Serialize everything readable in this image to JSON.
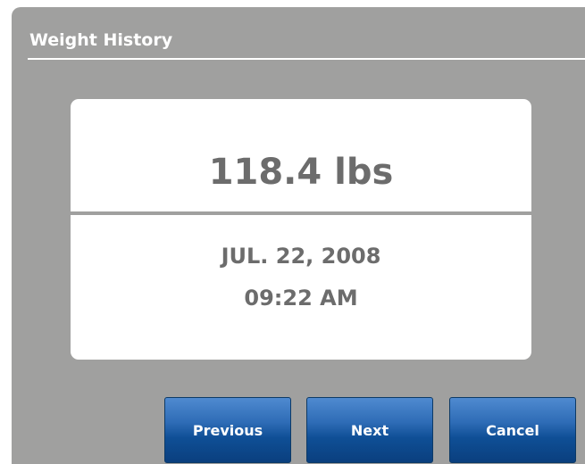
{
  "header": {
    "title": "Weight History"
  },
  "record": {
    "weight": "118.4 lbs",
    "date": "JUL. 22, 2008",
    "time": "09:22 AM"
  },
  "buttons": {
    "previous_label": "Previous",
    "next_label": "Next",
    "cancel_label": "Cancel"
  },
  "colors": {
    "panel_background": "#a0a09f",
    "card_background": "#ffffff",
    "value_text": "#6c6c6c",
    "button_blue": "#1f5fa8"
  }
}
